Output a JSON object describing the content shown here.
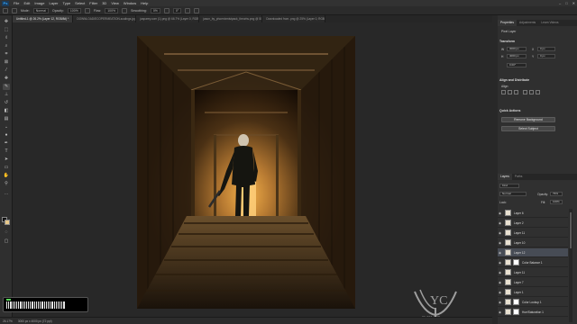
{
  "menubar": {
    "logo": "Ps",
    "items": [
      "File",
      "Edit",
      "Image",
      "Layer",
      "Type",
      "Select",
      "Filter",
      "3D",
      "View",
      "Window",
      "Help"
    ],
    "window_controls": [
      "–",
      "□",
      "✕"
    ]
  },
  "options": {
    "mode_label": "Mode:",
    "mode_value": "Normal",
    "opacity_label": "Opacity:",
    "opacity_value": "100%",
    "flow_label": "Flow:",
    "flow_value": "100%",
    "smoothing_label": "Smoothing:",
    "smoothing_value": "0%",
    "angle_value": "0°"
  },
  "tabs": [
    {
      "label": "Untitled-1 @ 26.2% (Layer 12, RGB/8#) *",
      "active": true
    },
    {
      "label": "DOWNLOAD/ECOPERMEATION-scalings.jpg @ 50% (RGB/8)",
      "active": false
    },
    {
      "label": "jasparey.com (1).png @ 66.7% (Layer 0, RGB/8)",
      "active": false
    },
    {
      "label": "jason_by_phoenixmistpack_theorhs.png @ 50% (Layer 0, RGB/8)",
      "active": false
    },
    {
      "label": "Downloaded from .png @ 25% (Layer 0, RGB/8)",
      "active": false
    }
  ],
  "status": {
    "zoom": "26.17%",
    "doc_size": "3000 px x 4000 px (72 ppi)"
  },
  "watermark": {
    "logo_text": "YC",
    "text": "yc.xxx.com"
  },
  "properties_panel": {
    "tabs": [
      "Properties",
      "Adjustments",
      "Learn Videos"
    ],
    "layer_type": "Pixel Layer",
    "transform_title": "Transform",
    "w_label": "W",
    "w_value": "3000 px",
    "h_label": "H",
    "h_value": "4000 px",
    "x_label": "X",
    "x_value": "0 px",
    "y_label": "Y",
    "y_value": "0 px",
    "angle_value": "0.00°",
    "align_title": "Align and Distribute",
    "align_sub": "Align:",
    "quick_actions_title": "Quick Actions",
    "remove_bg_label": "Remove Background",
    "select_subject_label": "Select Subject"
  },
  "layers_panel": {
    "tabs": [
      "Layers",
      "Paths"
    ],
    "kind_label": "Kind",
    "blend_mode": "Normal",
    "opacity_label": "Opacity:",
    "opacity_value": "79%",
    "lock_label": "Lock:",
    "fill_label": "Fill:",
    "fill_value": "100%",
    "layers": [
      {
        "name": "Layer 6",
        "selected": false,
        "mask": false
      },
      {
        "name": "Layer 2",
        "selected": false,
        "mask": false
      },
      {
        "name": "Layer 11",
        "selected": false,
        "mask": false
      },
      {
        "name": "Layer 10",
        "selected": false,
        "mask": false
      },
      {
        "name": "Layer 12",
        "selected": true,
        "mask": false
      },
      {
        "name": "Color Balance 1",
        "selected": false,
        "mask": true
      },
      {
        "name": "Layer 11",
        "selected": false,
        "mask": false
      },
      {
        "name": "Layer 7",
        "selected": false,
        "mask": false
      },
      {
        "name": "Layer 1",
        "selected": false,
        "mask": false
      },
      {
        "name": "Color Lookup 1",
        "selected": false,
        "mask": true
      },
      {
        "name": "Hue/Saturation 1",
        "selected": false,
        "mask": true
      }
    ]
  },
  "colors": {
    "accent": "#31a8ff",
    "foreground": "#111111",
    "background": "#e8c98a",
    "timeline": "#59d359"
  }
}
